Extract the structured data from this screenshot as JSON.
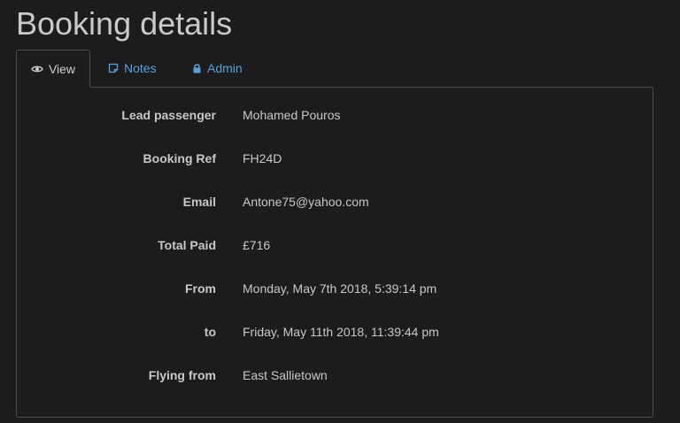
{
  "page": {
    "title": "Booking details"
  },
  "tabs": [
    {
      "label": "View",
      "icon": "eye-icon",
      "active": true
    },
    {
      "label": "Notes",
      "icon": "note-icon",
      "active": false
    },
    {
      "label": "Admin",
      "icon": "lock-icon",
      "active": false
    }
  ],
  "details": [
    {
      "label": "Lead passenger",
      "value": "Mohamed Pouros"
    },
    {
      "label": "Booking Ref",
      "value": "FH24D"
    },
    {
      "label": "Email",
      "value": "Antone75@yahoo.com"
    },
    {
      "label": "Total Paid",
      "value": "£716"
    },
    {
      "label": "From",
      "value": "Monday, May 7th 2018, 5:39:14 pm"
    },
    {
      "label": "to",
      "value": "Friday, May 11th 2018, 11:39:44 pm"
    },
    {
      "label": "Flying from",
      "value": "East Sallietown"
    }
  ],
  "colors": {
    "background": "#1c1c1e",
    "link": "#5aa0d8",
    "text": "#c8c8c8",
    "border": "#4a4a4c"
  }
}
